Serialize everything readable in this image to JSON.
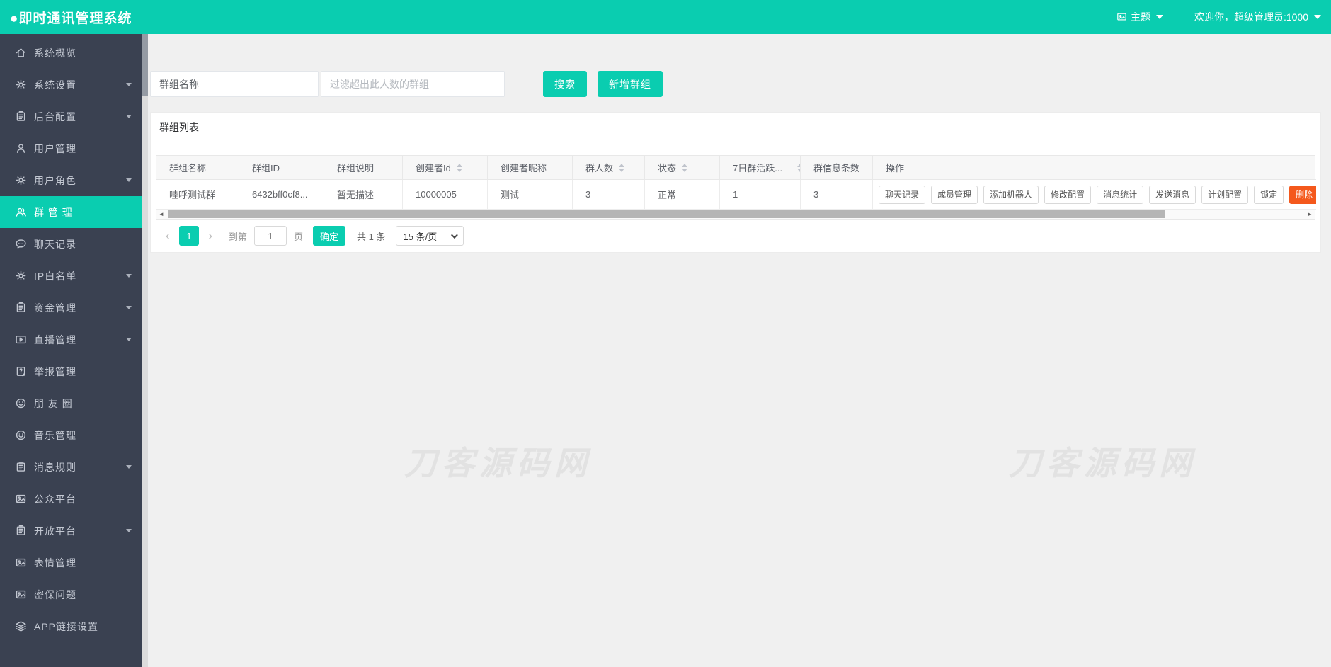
{
  "colors": {
    "accent": "#0acdb0",
    "danger": "#f4581c",
    "sidebar_bg": "#3a4151"
  },
  "header": {
    "title": "●即时通讯管理系统",
    "theme_label": "主题",
    "welcome": "欢迎你，超级管理员:1000"
  },
  "sidebar": {
    "items": [
      {
        "label": "系统概览",
        "icon": "home-icon",
        "expandable": false,
        "active": false
      },
      {
        "label": "系统设置",
        "icon": "gear-icon",
        "expandable": true,
        "active": false
      },
      {
        "label": "后台配置",
        "icon": "clipboard-icon",
        "expandable": true,
        "active": false
      },
      {
        "label": "用户管理",
        "icon": "user-icon",
        "expandable": false,
        "active": false
      },
      {
        "label": "用户角色",
        "icon": "gear-icon",
        "expandable": true,
        "active": false
      },
      {
        "label": "群 管 理",
        "icon": "users-icon",
        "expandable": false,
        "active": true
      },
      {
        "label": "聊天记录",
        "icon": "chat-icon",
        "expandable": false,
        "active": false
      },
      {
        "label": "IP白名单",
        "icon": "gear-icon",
        "expandable": true,
        "active": false
      },
      {
        "label": "资金管理",
        "icon": "clipboard-icon",
        "expandable": true,
        "active": false
      },
      {
        "label": "直播管理",
        "icon": "video-icon",
        "expandable": true,
        "active": false
      },
      {
        "label": "举报管理",
        "icon": "report-icon",
        "expandable": false,
        "active": false
      },
      {
        "label": "朋 友 圈",
        "icon": "smile-icon",
        "expandable": false,
        "active": false
      },
      {
        "label": "音乐管理",
        "icon": "smile-icon",
        "expandable": false,
        "active": false
      },
      {
        "label": "消息规则",
        "icon": "clipboard-icon",
        "expandable": true,
        "active": false
      },
      {
        "label": "公众平台",
        "icon": "image-icon",
        "expandable": false,
        "active": false
      },
      {
        "label": "开放平台",
        "icon": "clipboard-icon",
        "expandable": true,
        "active": false
      },
      {
        "label": "表情管理",
        "icon": "image-icon",
        "expandable": false,
        "active": false
      },
      {
        "label": "密保问题",
        "icon": "image-icon",
        "expandable": false,
        "active": false
      },
      {
        "label": "APP链接设置",
        "icon": "layers-icon",
        "expandable": false,
        "active": false
      }
    ]
  },
  "search": {
    "name_value": "群组名称",
    "filter_placeholder": "过滤超出此人数的群组",
    "search_button": "搜索",
    "add_button": "新增群组"
  },
  "panel": {
    "title": "群组列表"
  },
  "table": {
    "columns": [
      {
        "label": "群组名称",
        "sortable": false
      },
      {
        "label": "群组ID",
        "sortable": false
      },
      {
        "label": "群组说明",
        "sortable": false
      },
      {
        "label": "创建者Id",
        "sortable": true
      },
      {
        "label": "创建者昵称",
        "sortable": false
      },
      {
        "label": "群人数",
        "sortable": true
      },
      {
        "label": "状态",
        "sortable": true
      },
      {
        "label": "7日群活跃...",
        "sortable": true,
        "sort_clipped": true
      },
      {
        "label": "群信息条数",
        "sortable": false
      },
      {
        "label": "操作",
        "sortable": false
      }
    ],
    "rows": [
      {
        "cells": [
          "哇呼测试群",
          "6432bff0cf8...",
          "暂无描述",
          "10000005",
          "测试",
          "3",
          "正常",
          "1",
          "3"
        ]
      }
    ],
    "actions": [
      {
        "label": "聊天记录",
        "danger": false
      },
      {
        "label": "成员管理",
        "danger": false
      },
      {
        "label": "添加机器人",
        "danger": false
      },
      {
        "label": "修改配置",
        "danger": false
      },
      {
        "label": "消息统计",
        "danger": false
      },
      {
        "label": "发送消息",
        "danger": false
      },
      {
        "label": "计划配置",
        "danger": false
      },
      {
        "label": "锁定",
        "danger": false
      },
      {
        "label": "删除",
        "danger": true
      }
    ]
  },
  "pagination": {
    "prev": "‹",
    "page": "1",
    "next": "›",
    "goto_label": "到第",
    "goto_value": "1",
    "unit_label": "页",
    "confirm_button": "确定",
    "total": "共 1 条",
    "page_size": "15 条/页"
  },
  "watermark": "刀客源码网"
}
